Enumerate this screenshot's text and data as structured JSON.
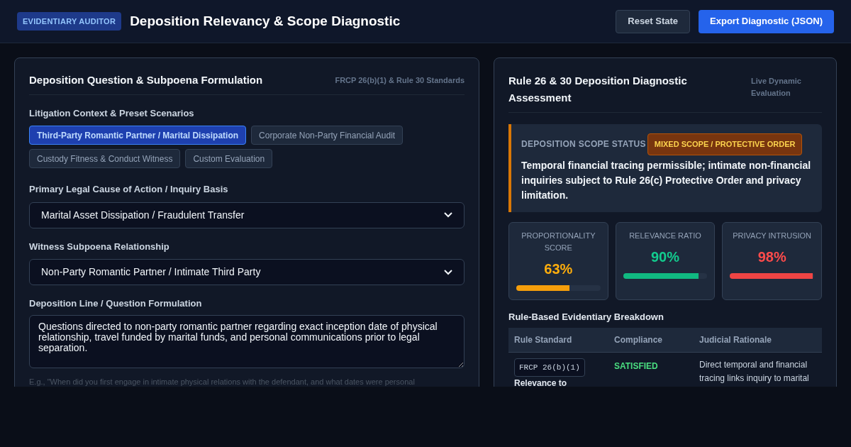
{
  "header": {
    "badge": "EVIDENTIARY AUDITOR",
    "title": "Deposition Relevancy & Scope Diagnostic",
    "buttons": [
      {
        "label": "Reset State",
        "kind": "secondary"
      },
      {
        "label": "Export Diagnostic (JSON)",
        "kind": "primary"
      }
    ]
  },
  "form_panel": {
    "title": "Deposition Question & Subpoena Formulation",
    "subtitle": "FRCP 26(b)(1) & Rule 30 Standards",
    "scenarios_label": "Litigation Context & Preset Scenarios",
    "scenarios": [
      {
        "label": "Third-Party Romantic Partner / Marital Dissipation",
        "selected": true
      },
      {
        "label": "Corporate Non-Party Financial Audit",
        "selected": false
      },
      {
        "label": "Custody Fitness & Conduct Witness",
        "selected": false
      },
      {
        "label": "Custom Evaluation",
        "selected": false
      }
    ],
    "cause_label": "Primary Legal Cause of Action / Inquiry Basis",
    "cause_value": "Marital Asset Dissipation / Fraudulent Transfer",
    "relationship_label": "Witness Subpoena Relationship",
    "relationship_value": "Non-Party Romantic Partner / Intimate Third Party",
    "question_label": "Deposition Line / Question Formulation",
    "question_value": "Questions directed to non-party romantic partner regarding exact inception date of physical relationship, travel funded by marital funds, and personal communications prior to legal separation.",
    "hint": "E.g., \"When did you first engage in intimate physical relations with the defendant, and what dates were personal"
  },
  "assessment_panel": {
    "title": "Rule 26 & 30 Deposition Diagnostic Assessment",
    "subtitle": "Live Dynamic Evaluation",
    "status_label": "DEPOSITION SCOPE STATUS",
    "status_badge": "MIXED SCOPE / PROTECTIVE ORDER",
    "status_text": "Temporal financial tracing permissible; intimate non-financial inquiries subject to Rule 26(c) Protective Order and privacy limitation.",
    "metrics": [
      {
        "label": "PROPORTIONALITY SCORE",
        "value": "63%",
        "level": 0.63,
        "color": "#f59e0b"
      },
      {
        "label": "RELEVANCE RATIO",
        "value": "90%",
        "level": 0.9,
        "color": "#10b981"
      },
      {
        "label": "PRIVACY INTRUSION",
        "value": "98%",
        "level": 0.98,
        "color": "#ef4444"
      }
    ],
    "breakdown_title": "Rule-Based Evidentiary Breakdown",
    "table": {
      "columns": [
        "Rule Standard",
        "Compliance",
        "Judicial Rationale"
      ],
      "rows": [
        {
          "code": "FRCP 26(b)(1)",
          "rule": "Relevance to",
          "compliance": "SATISFIED",
          "kind": "satisfied",
          "rationale": "Direct temporal and financial tracing links inquiry to marital"
        }
      ]
    }
  }
}
